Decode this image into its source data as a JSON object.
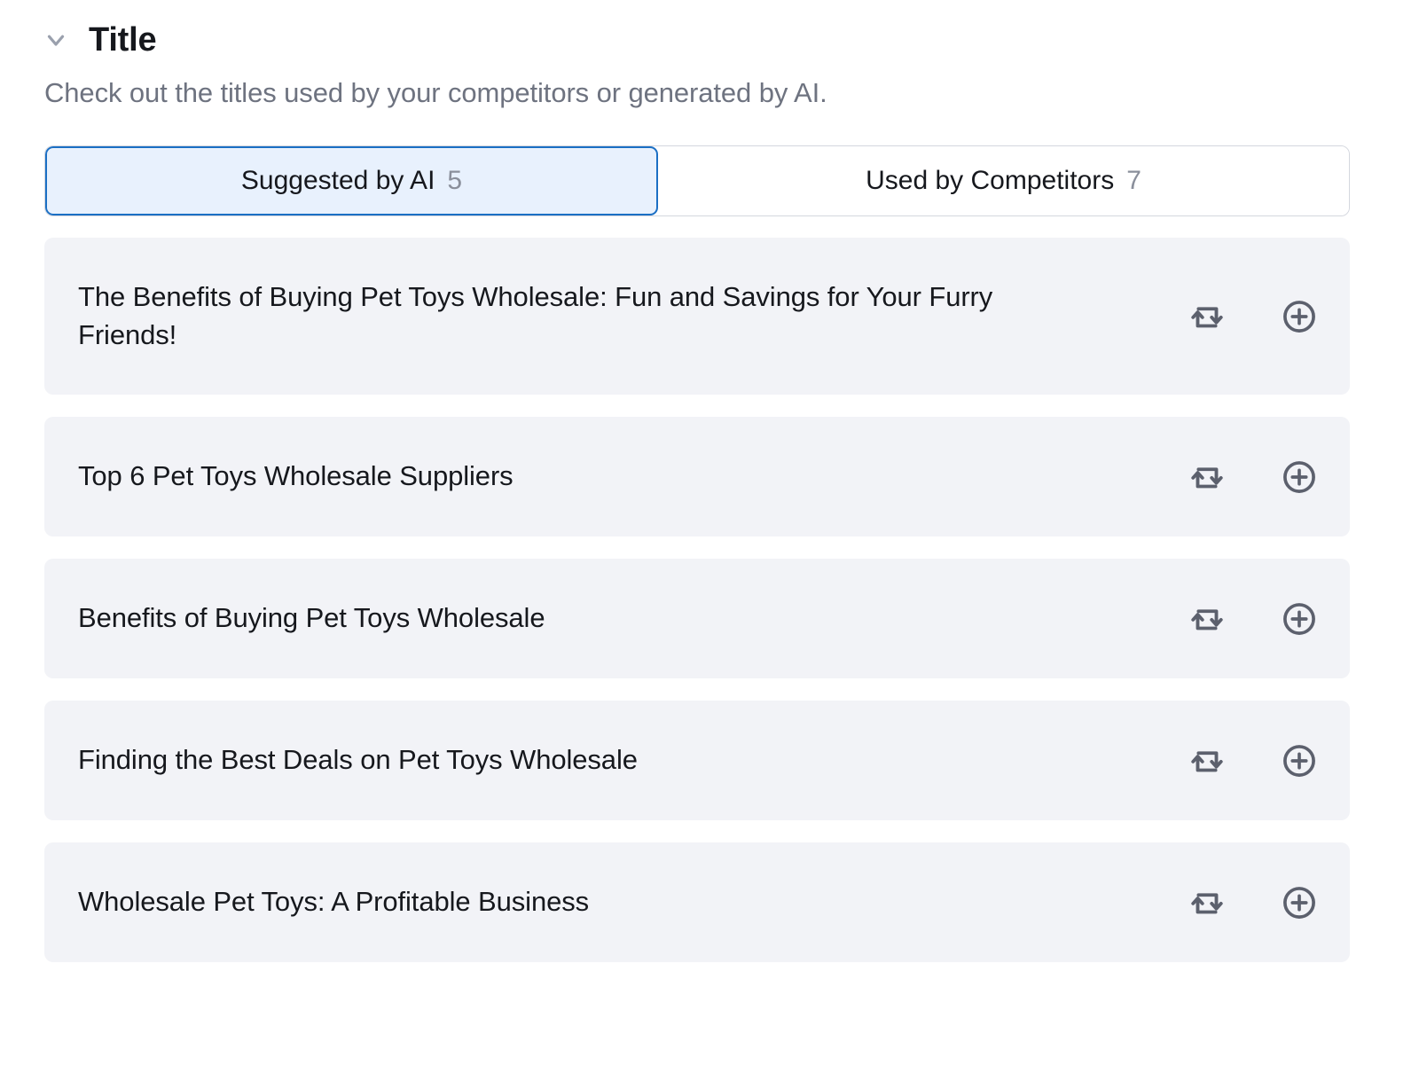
{
  "section": {
    "title": "Title",
    "subtitle": "Check out the titles used by your competitors or generated by AI.",
    "collapse_icon": "chevron-down-icon",
    "expanded": true
  },
  "tabs": [
    {
      "label": "Suggested by AI",
      "count": "5",
      "active": true
    },
    {
      "label": "Used by Competitors",
      "count": "7",
      "active": false
    }
  ],
  "titles": [
    {
      "text": "The Benefits of Buying Pet Toys Wholesale: Fun and Savings for Your Furry Friends!",
      "replace_icon": "repeat-icon",
      "add_icon": "plus-circle-icon"
    },
    {
      "text": "Top 6 Pet Toys Wholesale Suppliers",
      "replace_icon": "repeat-icon",
      "add_icon": "plus-circle-icon"
    },
    {
      "text": "Benefits of Buying Pet Toys Wholesale",
      "replace_icon": "repeat-icon",
      "add_icon": "plus-circle-icon"
    },
    {
      "text": "Finding the Best Deals on Pet Toys Wholesale",
      "replace_icon": "repeat-icon",
      "add_icon": "plus-circle-icon"
    },
    {
      "text": "Wholesale Pet Toys: A Profitable Business",
      "replace_icon": "repeat-icon",
      "add_icon": "plus-circle-icon"
    }
  ],
  "colors": {
    "accent": "#1b6fc4",
    "accent_bg": "#e8f1fd",
    "row_bg": "#f2f3f7",
    "text": "#16181d",
    "muted": "#6e7380",
    "icon": "#5c606d",
    "border": "#d4d7de"
  }
}
